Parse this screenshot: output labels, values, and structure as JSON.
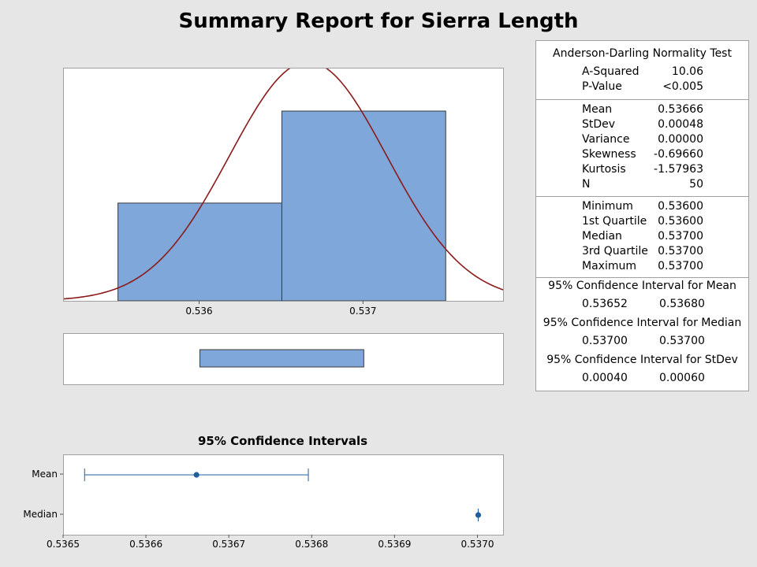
{
  "title": "Summary Report for Sierra Length",
  "stats": {
    "ad_title": "Anderson-Darling Normality Test",
    "ad_rows": [
      {
        "label": "A-Squared",
        "value": "10.06"
      },
      {
        "label": "P-Value",
        "value": "<0.005"
      }
    ],
    "moment_rows": [
      {
        "label": "Mean",
        "value": "0.53666"
      },
      {
        "label": "StDev",
        "value": "0.00048"
      },
      {
        "label": "Variance",
        "value": "0.00000"
      },
      {
        "label": "Skewness",
        "value": "-0.69660"
      },
      {
        "label": "Kurtosis",
        "value": "-1.57963"
      },
      {
        "label": "N",
        "value": "50"
      }
    ],
    "quantile_rows": [
      {
        "label": "Minimum",
        "value": "0.53600"
      },
      {
        "label": "1st Quartile",
        "value": "0.53600"
      },
      {
        "label": "Median",
        "value": "0.53700"
      },
      {
        "label": "3rd Quartile",
        "value": "0.53700"
      },
      {
        "label": "Maximum",
        "value": "0.53700"
      }
    ],
    "ci_blocks": [
      {
        "title": "95% Confidence Interval for Mean",
        "lower": "0.53652",
        "upper": "0.53680"
      },
      {
        "title": "95% Confidence Interval for Median",
        "lower": "0.53700",
        "upper": "0.53700"
      },
      {
        "title": "95% Confidence Interval for StDev",
        "lower": "0.00040",
        "upper": "0.00060"
      }
    ]
  },
  "chart_data": [
    {
      "type": "bar",
      "bins": [
        {
          "from": 0.5355,
          "to": 0.5365,
          "count": 17
        },
        {
          "from": 0.5365,
          "to": 0.5375,
          "count": 33
        }
      ],
      "xlim": [
        0.53517,
        0.53785
      ],
      "ylim": [
        0,
        40.4
      ],
      "x_ticks": [
        "0.536",
        "0.537"
      ],
      "fitted_normal": {
        "mean": 0.53666,
        "stdev": 0.00048,
        "n": 50,
        "bin_width": 0.001,
        "color": "#8b1a1a"
      },
      "bar_color": "#7fa7d9"
    },
    {
      "type": "boxplot",
      "min": 0.536,
      "q1": 0.536,
      "median": 0.537,
      "q3": 0.537,
      "max": 0.537,
      "xlim": [
        0.53517,
        0.53785
      ],
      "color": "#7fa7d9"
    },
    {
      "type": "interval",
      "title": "95% Confidence Intervals",
      "categories": [
        "Mean",
        "Median"
      ],
      "intervals": [
        {
          "name": "Mean",
          "estimate": 0.53666,
          "lower": 0.536525,
          "upper": 0.536795
        },
        {
          "name": "Median",
          "estimate": 0.537,
          "lower": 0.537,
          "upper": 0.537
        }
      ],
      "xlim": [
        0.5365,
        0.53703
      ],
      "x_ticks": [
        "0.5365",
        "0.5366",
        "0.5367",
        "0.5368",
        "0.5369",
        "0.5370"
      ],
      "color": "#1f5fa0"
    }
  ]
}
